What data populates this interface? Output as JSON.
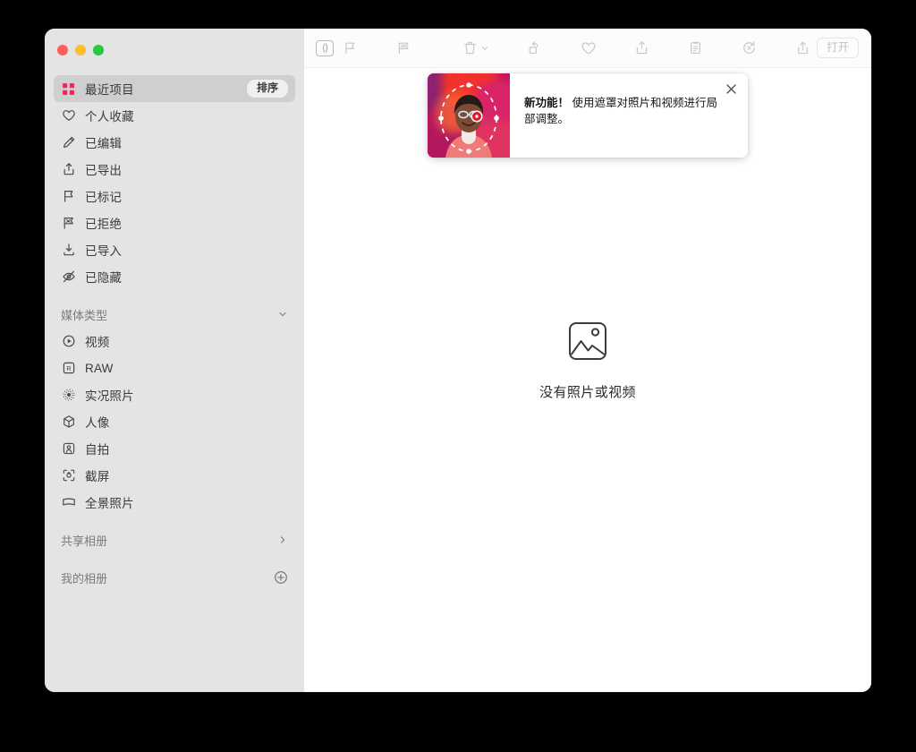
{
  "window": {
    "traffic_lights": [
      {
        "name": "close",
        "color": "#ff5f57"
      },
      {
        "name": "minimize",
        "color": "#febc2e"
      },
      {
        "name": "zoom",
        "color": "#28c840"
      }
    ]
  },
  "sidebar": {
    "items": [
      {
        "icon": "grid-squares-icon",
        "label": "最近项目",
        "selected": true,
        "trailing": "排序"
      },
      {
        "icon": "heart-icon",
        "label": "个人收藏",
        "selected": false
      },
      {
        "icon": "pencil-icon",
        "label": "已编辑",
        "selected": false
      },
      {
        "icon": "export-icon",
        "label": "已导出",
        "selected": false
      },
      {
        "icon": "flag-icon",
        "label": "已标记",
        "selected": false
      },
      {
        "icon": "flag-rejected-icon",
        "label": "已拒绝",
        "selected": false
      },
      {
        "icon": "import-icon",
        "label": "已导入",
        "selected": false
      },
      {
        "icon": "eye-slash-icon",
        "label": "已隐藏",
        "selected": false
      }
    ],
    "media_section": {
      "title": "媒体类型",
      "chevron": "chevron-down-icon",
      "items": [
        {
          "icon": "play-circle-icon",
          "label": "视频"
        },
        {
          "icon": "raw-badge-icon",
          "label": "RAW"
        },
        {
          "icon": "live-photo-icon",
          "label": "实况照片"
        },
        {
          "icon": "cube-icon",
          "label": "人像"
        },
        {
          "icon": "selfie-icon",
          "label": "自拍"
        },
        {
          "icon": "screenshot-icon",
          "label": "截屏"
        },
        {
          "icon": "panorama-icon",
          "label": "全景照片"
        }
      ]
    },
    "shared_albums": {
      "title": "共享相册",
      "chevron": "chevron-right-icon"
    },
    "my_albums": {
      "title": "我的相册",
      "action": "plus-circle-icon"
    }
  },
  "toolbar": {
    "sidebar_toggle": "sidebar-toggle-icon",
    "flag_button": "flag-icon",
    "reject_button": "flag-rejected-icon",
    "trash_button": "trash-icon",
    "trash_chevron": "chevron-down-icon",
    "rotate_button": "rotate-icon",
    "favorite_button": "heart-icon",
    "export_button": "export-box-icon",
    "info_button": "info-clipboard-icon",
    "revert_button": "revert-icon",
    "share_button": "share-icon",
    "open_label": "打开"
  },
  "banner": {
    "title": "新功能！",
    "body": " 使用遮罩对照片和视频进行局部调整。",
    "close_icon": "close-icon",
    "thumbnail_alt": "masking-preview-thumbnail"
  },
  "empty_state": {
    "icon": "photo-placeholder-icon",
    "label": "没有照片或视频"
  },
  "colors": {
    "window_background": "#ffffff",
    "sidebar_background": "#e4e4e4",
    "selected_row": "#cfcfcf",
    "accent_pink": "#f2285a",
    "page_background": "#000000"
  }
}
